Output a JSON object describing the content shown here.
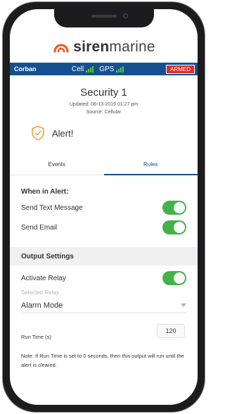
{
  "header": {
    "brand_bold": "siren",
    "brand_light": "marine"
  },
  "status_bar": {
    "vessel_name": "Corban",
    "cell_label": "Cell",
    "gps_label": "GPS",
    "armed_label": "ARMED",
    "armed_color": "#d93025",
    "bar_color": "#16518f",
    "signal_color": "#57c73d"
  },
  "device": {
    "name": "Security 1",
    "updated": "Updated: 08-13-2019 01:27 pm",
    "source": "Source: Cellular",
    "alert_label": "Alert!"
  },
  "tabs": [
    {
      "label": "Events",
      "active": false
    },
    {
      "label": "Rules",
      "active": true
    }
  ],
  "when_in_alert": {
    "heading": "When in Alert:",
    "send_text_label": "Send Text Message",
    "send_text_on": true,
    "send_email_label": "Send Email",
    "send_email_on": true
  },
  "output_settings": {
    "heading": "Output Settings",
    "activate_relay_label": "Activate Relay",
    "activate_relay_on": true,
    "selected_relay_label": "Selected Relay",
    "selected_relay_value": "Alarm Mode",
    "run_time_label": "Run Time (s)",
    "run_time_value": "120",
    "note": "Note: If Run Time is set to 0 seconds, then this output will run until the alert is cleared."
  },
  "colors": {
    "toggle_on": "#43b348",
    "alert_icon": "#f0a030",
    "logo_orange": "#f05a28"
  }
}
